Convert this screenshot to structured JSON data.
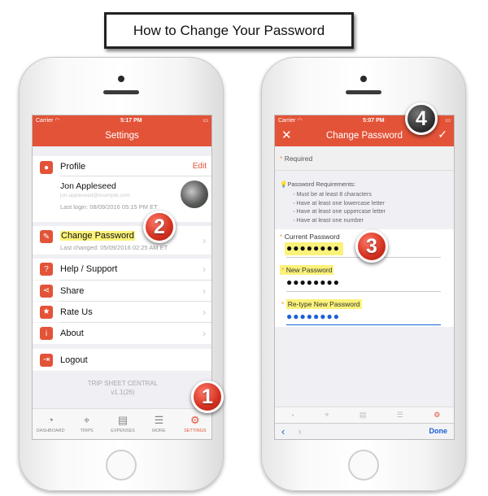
{
  "title": "How to Change Your Password",
  "colors": {
    "accent": "#e35338",
    "highlight": "#fbf27a",
    "link_blue": "#1a5fd6"
  },
  "left_screen": {
    "status": {
      "carrier": "Carrier",
      "time": "5:17 PM"
    },
    "nav_title": "Settings",
    "profile": {
      "label": "Profile",
      "edit": "Edit",
      "name": "Jon Appleseed",
      "email": "jon.appleseed@example.com",
      "last_login": "Last login: 08/09/2016 05:15 PM ET"
    },
    "change_password": {
      "label": "Change Password",
      "last_changed": "Last changed: 05/09/2016 02:25 AM ET"
    },
    "items": [
      {
        "label": "Help / Support",
        "icon": "help-icon"
      },
      {
        "label": "Share",
        "icon": "share-icon"
      },
      {
        "label": "Rate Us",
        "icon": "star-icon"
      },
      {
        "label": "About",
        "icon": "info-icon"
      }
    ],
    "logout": "Logout",
    "app_name": "TRIP SHEET CENTRAL",
    "version": "v1.1(26)",
    "tabs": [
      {
        "label": "DASHBOARD",
        "icon": "gauge-icon"
      },
      {
        "label": "TRIPS",
        "icon": "route-icon"
      },
      {
        "label": "EXPENSES",
        "icon": "receipt-icon"
      },
      {
        "label": "MORE",
        "icon": "sliders-icon"
      },
      {
        "label": "SETTINGS",
        "icon": "gear-icon"
      }
    ]
  },
  "right_screen": {
    "status": {
      "carrier": "Carrier",
      "time": "5:07 PM"
    },
    "nav_title": "Change Password",
    "required": "Required",
    "requirements_title": "Password Requirements:",
    "requirements": [
      "Must be at least 8 characters",
      "Have at least one lowercase letter",
      "Have at least one uppercase letter",
      "Have at least one number"
    ],
    "current_label": "Current Password",
    "current_value": "●●●●●●●●",
    "new_label": "New Password",
    "new_value": "●●●●●●●●",
    "retype_label": "Re-type New Password",
    "retype_value": "●●●●●●●●",
    "done": "Done"
  },
  "badges": [
    "1",
    "2",
    "3",
    "4"
  ]
}
